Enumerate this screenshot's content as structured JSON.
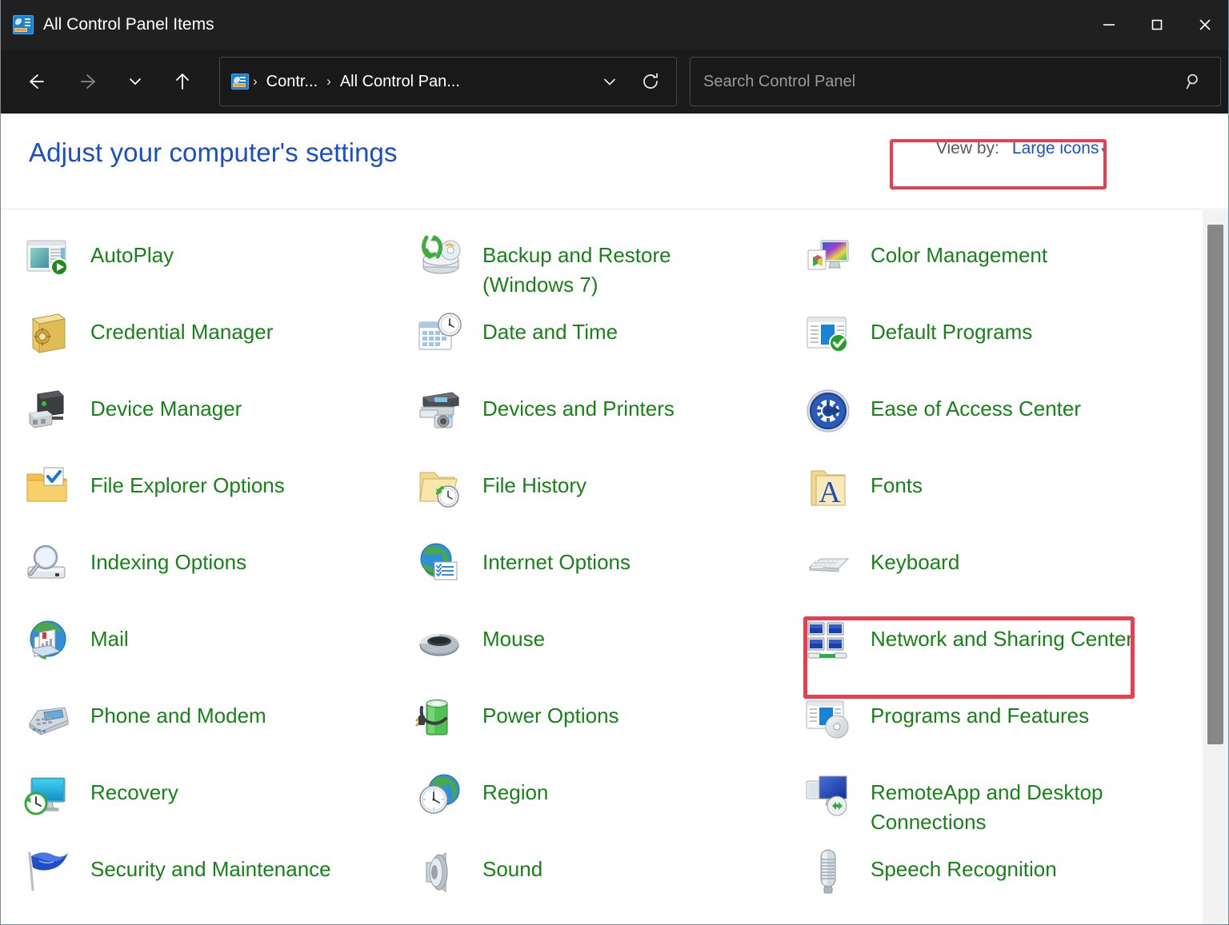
{
  "window": {
    "title": "All Control Panel Items",
    "icon": "control-panel-icon",
    "controls": {
      "minimize": "minimize-button",
      "maximize": "maximize-button",
      "close": "close-button"
    }
  },
  "nav": {
    "back": "back-arrow-icon",
    "forward": "forward-arrow-icon",
    "recent": "chevron-down-icon",
    "up": "up-arrow-icon",
    "breadcrumb": {
      "icon": "control-panel-icon",
      "separator": "›",
      "crumbs": [
        "Contr...",
        "All Control Pan..."
      ]
    },
    "address_dropdown": "chevron-down-icon",
    "refresh": "refresh-icon"
  },
  "search": {
    "placeholder": "Search Control Panel",
    "value": "",
    "icon": "search-icon"
  },
  "header": {
    "page_title": "Adjust your computer's settings",
    "view_by_label": "View by:",
    "view_by_value": "Large icons",
    "view_by_caret": "▾",
    "highlight_color": "#EF3B4E"
  },
  "colors": {
    "titlebar_bg": "#202020",
    "navbar_bg": "#1b1b1b",
    "content_bg": "#ffffff",
    "item_label": "#178218",
    "page_title": "#1A4FC4",
    "link_blue": "#1655C8",
    "annotation_red": "#EF3B4E",
    "scrollbar_thumb": "#878787"
  },
  "items": [
    {
      "label": "AutoPlay",
      "icon": "autoplay-icon",
      "column": 1,
      "row": 1,
      "highlighted": false
    },
    {
      "label": "Backup and Restore (Windows 7)",
      "icon": "backup-and-restore-icon",
      "column": 2,
      "row": 1,
      "highlighted": false
    },
    {
      "label": "Color Management",
      "icon": "color-management-icon",
      "column": 3,
      "row": 1,
      "highlighted": false
    },
    {
      "label": "Credential Manager",
      "icon": "credential-manager-icon",
      "column": 1,
      "row": 2,
      "highlighted": false
    },
    {
      "label": "Date and Time",
      "icon": "date-and-time-icon",
      "column": 2,
      "row": 2,
      "highlighted": false
    },
    {
      "label": "Default Programs",
      "icon": "default-programs-icon",
      "column": 3,
      "row": 2,
      "highlighted": false
    },
    {
      "label": "Device Manager",
      "icon": "device-manager-icon",
      "column": 1,
      "row": 3,
      "highlighted": false
    },
    {
      "label": "Devices and Printers",
      "icon": "devices-and-printers-icon",
      "column": 2,
      "row": 3,
      "highlighted": false
    },
    {
      "label": "Ease of Access Center",
      "icon": "ease-of-access-center-icon",
      "column": 3,
      "row": 3,
      "highlighted": true
    },
    {
      "label": "File Explorer Options",
      "icon": "file-explorer-options-icon",
      "column": 1,
      "row": 4,
      "highlighted": false
    },
    {
      "label": "File History",
      "icon": "file-history-icon",
      "column": 2,
      "row": 4,
      "highlighted": false
    },
    {
      "label": "Fonts",
      "icon": "fonts-icon",
      "column": 3,
      "row": 4,
      "highlighted": false
    },
    {
      "label": "Indexing Options",
      "icon": "indexing-options-icon",
      "column": 1,
      "row": 5,
      "highlighted": false
    },
    {
      "label": "Internet Options",
      "icon": "internet-options-icon",
      "column": 2,
      "row": 5,
      "highlighted": false
    },
    {
      "label": "Keyboard",
      "icon": "keyboard-icon",
      "column": 3,
      "row": 5,
      "highlighted": false
    },
    {
      "label": "Mail",
      "icon": "mail-icon",
      "column": 1,
      "row": 6,
      "highlighted": false
    },
    {
      "label": "Mouse",
      "icon": "mouse-icon",
      "column": 2,
      "row": 6,
      "highlighted": false
    },
    {
      "label": "Network and Sharing Center",
      "icon": "network-and-sharing-center-icon",
      "column": 3,
      "row": 6,
      "highlighted": false
    },
    {
      "label": "Phone and Modem",
      "icon": "phone-and-modem-icon",
      "column": 1,
      "row": 7,
      "highlighted": false
    },
    {
      "label": "Power Options",
      "icon": "power-options-icon",
      "column": 2,
      "row": 7,
      "highlighted": false
    },
    {
      "label": "Programs and Features",
      "icon": "programs-and-features-icon",
      "column": 3,
      "row": 7,
      "highlighted": false
    },
    {
      "label": "Recovery",
      "icon": "recovery-icon",
      "column": 1,
      "row": 8,
      "highlighted": false
    },
    {
      "label": "Region",
      "icon": "region-icon",
      "column": 2,
      "row": 8,
      "highlighted": false
    },
    {
      "label": "RemoteApp and Desktop Connections",
      "icon": "remoteapp-and-desktop-connections-icon",
      "column": 3,
      "row": 8,
      "highlighted": false
    },
    {
      "label": "Security and Maintenance",
      "icon": "security-and-maintenance-icon",
      "column": 1,
      "row": 9,
      "highlighted": false
    },
    {
      "label": "Sound",
      "icon": "sound-icon",
      "column": 2,
      "row": 9,
      "highlighted": false
    },
    {
      "label": "Speech Recognition",
      "icon": "speech-recognition-icon",
      "column": 3,
      "row": 9,
      "highlighted": false
    }
  ]
}
